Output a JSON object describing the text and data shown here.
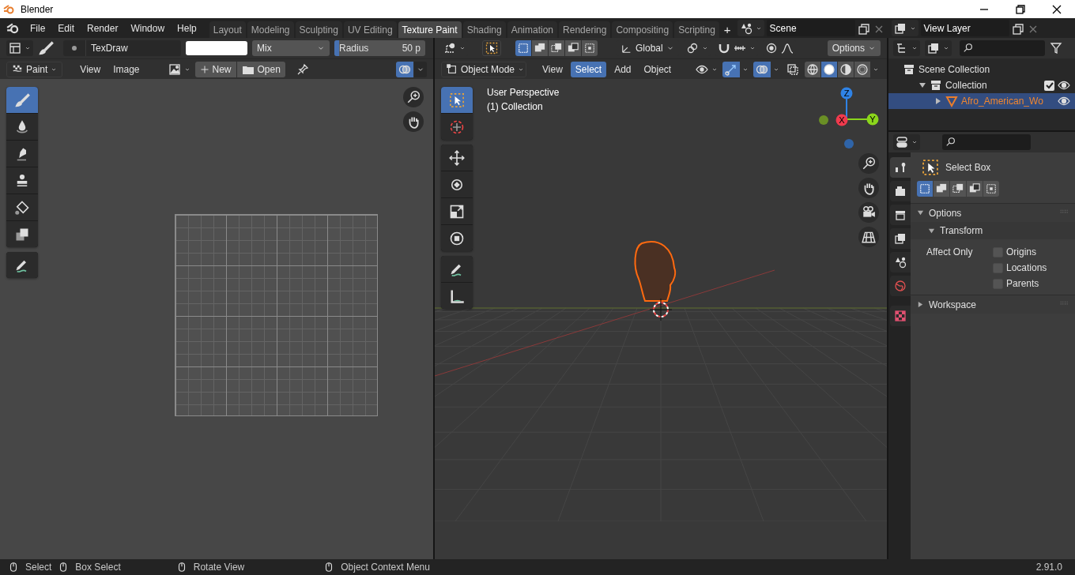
{
  "window": {
    "title": "Blender"
  },
  "menu": [
    "File",
    "Edit",
    "Render",
    "Window",
    "Help"
  ],
  "workspace_tabs": [
    {
      "label": "Layout",
      "selected": false
    },
    {
      "label": "Modeling",
      "selected": false
    },
    {
      "label": "Sculpting",
      "selected": false
    },
    {
      "label": "UV Editing",
      "selected": false
    },
    {
      "label": "Texture Paint",
      "selected": true
    },
    {
      "label": "Shading",
      "selected": false
    },
    {
      "label": "Animation",
      "selected": false
    },
    {
      "label": "Rendering",
      "selected": false
    },
    {
      "label": "Compositing",
      "selected": false
    },
    {
      "label": "Scripting",
      "selected": false
    }
  ],
  "add_workspace": "+",
  "scene": {
    "name": "Scene"
  },
  "view_layer": {
    "name": "View Layer"
  },
  "image_editor": {
    "brush_name": "TexDraw",
    "blend": "Mix",
    "radius": {
      "label": "Radius",
      "value": "50 p",
      "level": 0.05
    },
    "mode": "Paint",
    "menus": [
      "View",
      "Image"
    ],
    "new_label": "New",
    "open_label": "Open",
    "tools": [
      {
        "selected": true
      },
      {
        "selected": false
      },
      {
        "selected": false
      },
      {
        "selected": false
      },
      {
        "selected": false
      },
      {
        "selected": false
      },
      {
        "selected": false
      }
    ]
  },
  "viewport": {
    "select_modes": [
      {
        "selected": true
      },
      {
        "selected": false
      },
      {
        "selected": false
      },
      {
        "selected": false
      },
      {
        "selected": false
      }
    ],
    "orientation": "Global",
    "options": "Options",
    "mode": "Object Mode",
    "menus": [
      {
        "label": "View",
        "selected": false
      },
      {
        "label": "Select",
        "selected": true
      },
      {
        "label": "Add",
        "selected": false
      },
      {
        "label": "Object",
        "selected": false
      }
    ],
    "shading": [
      {
        "selected": false
      },
      {
        "selected": true
      },
      {
        "selected": false
      },
      {
        "selected": false
      }
    ],
    "tools": [
      {
        "selected": true
      },
      {
        "selected": false
      },
      {
        "selected": false
      },
      {
        "selected": false
      },
      {
        "selected": false
      },
      {
        "selected": false
      },
      {
        "selected": false
      },
      {
        "selected": false
      }
    ],
    "overlay_text": [
      "User Perspective",
      "(1) Collection"
    ],
    "gizmo_axes": [
      "Z",
      "X",
      "Y"
    ]
  },
  "outliner": {
    "tree": [
      {
        "label": "Scene Collection",
        "children": [
          {
            "label": "Collection",
            "expanded": true,
            "checked": true,
            "selected": false,
            "children": [
              {
                "label": "Afro_American_Wo",
                "expanded": false,
                "selected": true
              }
            ]
          }
        ]
      }
    ]
  },
  "properties": {
    "tabs": [
      {
        "selected": true
      },
      {
        "selected": false
      },
      {
        "selected": false
      },
      {
        "selected": false
      },
      {
        "selected": false
      },
      {
        "selected": false
      },
      {
        "selected": false
      }
    ],
    "tool_name": "Select Box",
    "select_modes": [
      {
        "selected": true
      },
      {
        "selected": false
      },
      {
        "selected": false
      },
      {
        "selected": false
      },
      {
        "selected": false
      }
    ],
    "panels": [
      {
        "title": "Options",
        "expanded": true,
        "subpanels": [
          {
            "title": "Transform",
            "expanded": true,
            "field_label": "Affect Only",
            "options": [
              {
                "label": "Origins",
                "checked": false
              },
              {
                "label": "Locations",
                "checked": false
              },
              {
                "label": "Parents",
                "checked": false
              }
            ]
          }
        ]
      },
      {
        "title": "Workspace",
        "expanded": false
      }
    ]
  },
  "status_bar": {
    "hints": [
      "Select",
      "Box Select",
      "Rotate View",
      "Object Context Menu"
    ],
    "version": "2.91.0"
  }
}
